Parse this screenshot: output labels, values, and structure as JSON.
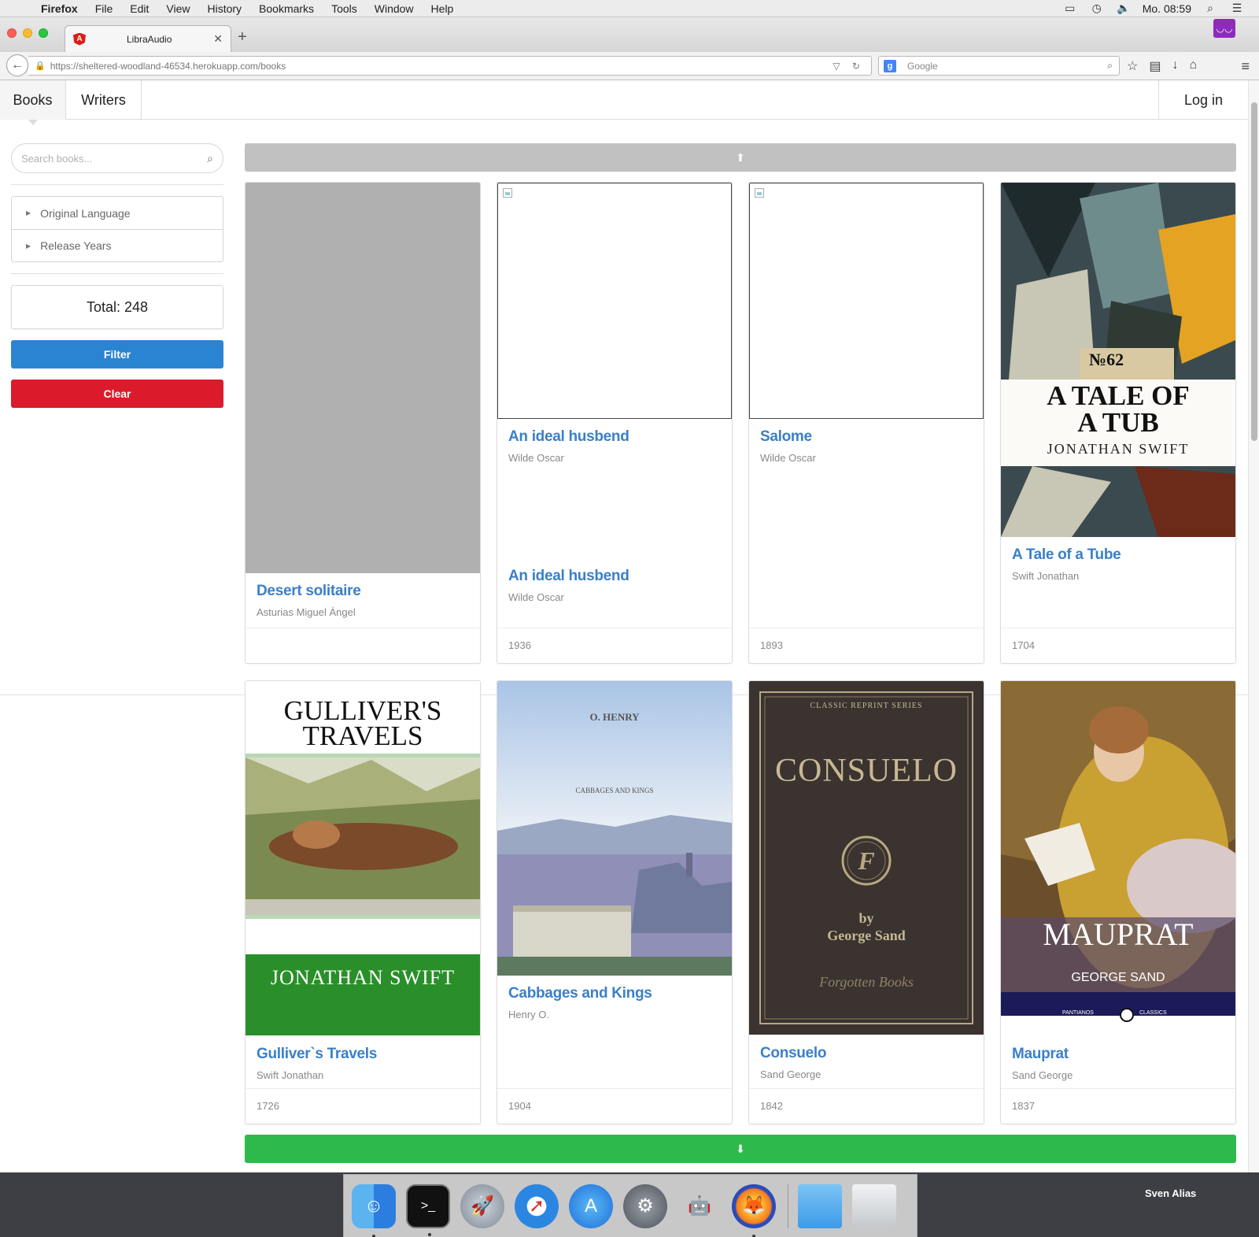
{
  "menubar": {
    "app_name": "Firefox",
    "items": [
      "File",
      "Edit",
      "View",
      "History",
      "Bookmarks",
      "Tools",
      "Window",
      "Help"
    ],
    "clock": "Mo. 08:59"
  },
  "browser": {
    "tab_title": "LibraAudio",
    "url_host": "https://sheltered-woodland-46534.herokuapp.com",
    "url_path": "/books",
    "search_placeholder": "Google"
  },
  "nav": {
    "books": "Books",
    "writers": "Writers",
    "login": "Log in"
  },
  "sidebar": {
    "search_placeholder": "Search books...",
    "filters": [
      "Original Language",
      "Release Years"
    ],
    "total": "Total: 248",
    "filter_btn": "Filter",
    "clear_btn": "Clear"
  },
  "books": [
    {
      "title": "Desert solitaire",
      "author": "Asturias Miguel Ángel",
      "year": ""
    },
    {
      "title": "An ideal husbend",
      "author": "Wilde Oscar",
      "title2": "An ideal husbend",
      "author2": "Wilde Oscar",
      "year": "1936"
    },
    {
      "title": "Salome",
      "author": "Wilde Oscar",
      "year": "1893"
    },
    {
      "title": "A Tale of a Tube",
      "author": "Swift Jonathan",
      "year": "1704",
      "cover_text": [
        "A TALE OF",
        "A TUB",
        "JONATHAN SWIFT",
        "№62"
      ]
    },
    {
      "title": "Gulliver`s Travels",
      "author": "Swift Jonathan",
      "year": "1726",
      "cover_text": [
        "GULLIVER'S",
        "TRAVELS",
        "JONATHAN SWIFT"
      ]
    },
    {
      "title": "Cabbages and Kings",
      "author": "Henry O.",
      "year": "1904",
      "cover_text": [
        "O. HENRY",
        "CABBAGES AND KINGS"
      ]
    },
    {
      "title": "Consuelo",
      "author": "Sand George",
      "year": "1842",
      "cover_text": [
        "CLASSIC REPRINT SERIES",
        "CONSUELO",
        "F",
        "by",
        "George Sand",
        "Forgotten Books"
      ]
    },
    {
      "title": "Mauprat",
      "author": "Sand George",
      "year": "1837",
      "cover_text": [
        "MAUPRAT",
        "GEORGE SAND",
        "PANTIANOS",
        "CLASSICS"
      ]
    }
  ],
  "dock": {
    "user": "Sven Alias"
  },
  "colors": {
    "link": "#3a7fc8",
    "filter": "#2b84d2",
    "clear": "#db1b2b",
    "next_page": "#2eba4b",
    "prev_page": "#c1c1c1"
  }
}
